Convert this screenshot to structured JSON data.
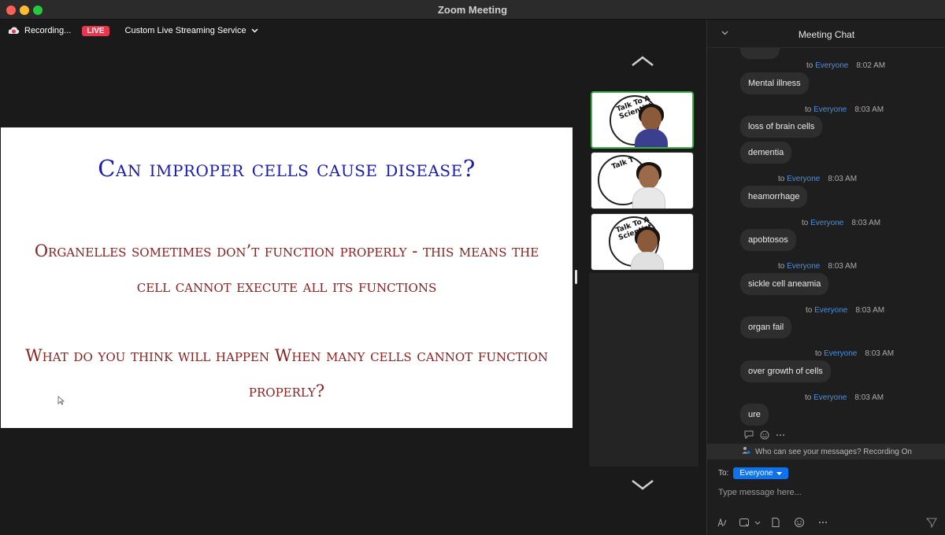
{
  "window": {
    "title": "Zoom Meeting"
  },
  "status": {
    "recording_label": "Recording...",
    "live_badge": "LIVE",
    "streaming_service": "Custom Live Streaming Service"
  },
  "slide": {
    "title": "Can improper cells cause disease?",
    "paragraph1": "Organelles sometimes don’t function properly - this means the cell cannot execute all its functions",
    "paragraph2": "What do you think will happen When many cells cannot function properly?"
  },
  "gallery": {
    "tiles": [
      {
        "logo_text": "Talk To A Scientist"
      },
      {
        "logo_text": "Talk T"
      },
      {
        "logo_text": "Talk To A Scientist"
      }
    ]
  },
  "chat": {
    "header": "Meeting Chat",
    "messages": [
      {
        "to": "to",
        "recipient": "Everyone",
        "time": "8:02 AM",
        "text": "Mental illness"
      },
      {
        "to": "to",
        "recipient": "Everyone",
        "time": "8:03 AM",
        "text": "loss of brain cells"
      },
      {
        "to": "",
        "recipient": "",
        "time": "",
        "text": "dementia"
      },
      {
        "to": "to",
        "recipient": "Everyone",
        "time": "8:03 AM",
        "text": "heamorrhage"
      },
      {
        "to": "to",
        "recipient": "Everyone",
        "time": "8:03 AM",
        "text": "apobtosos"
      },
      {
        "to": "to",
        "recipient": "Everyone",
        "time": "8:03 AM",
        "text": "sickle cell aneamia"
      },
      {
        "to": "to",
        "recipient": "Everyone",
        "time": "8:03 AM",
        "text": "organ fail"
      },
      {
        "to": "to",
        "recipient": "Everyone",
        "time": "8:03 AM",
        "text": "over growth of cells"
      },
      {
        "to": "to",
        "recipient": "Everyone",
        "time": "8:03 AM",
        "text": "ure"
      }
    ],
    "notice": "Who can see your messages? Recording On",
    "to_label": "To:",
    "recipient_select": "Everyone",
    "input_placeholder": "Type message here..."
  },
  "colors": {
    "accent": "#0e72ed",
    "live": "#e8384f",
    "link": "#4a90e2",
    "active_speaker": "#3cb043",
    "slide_title": "#1c1cae",
    "slide_text": "#8b2020"
  }
}
